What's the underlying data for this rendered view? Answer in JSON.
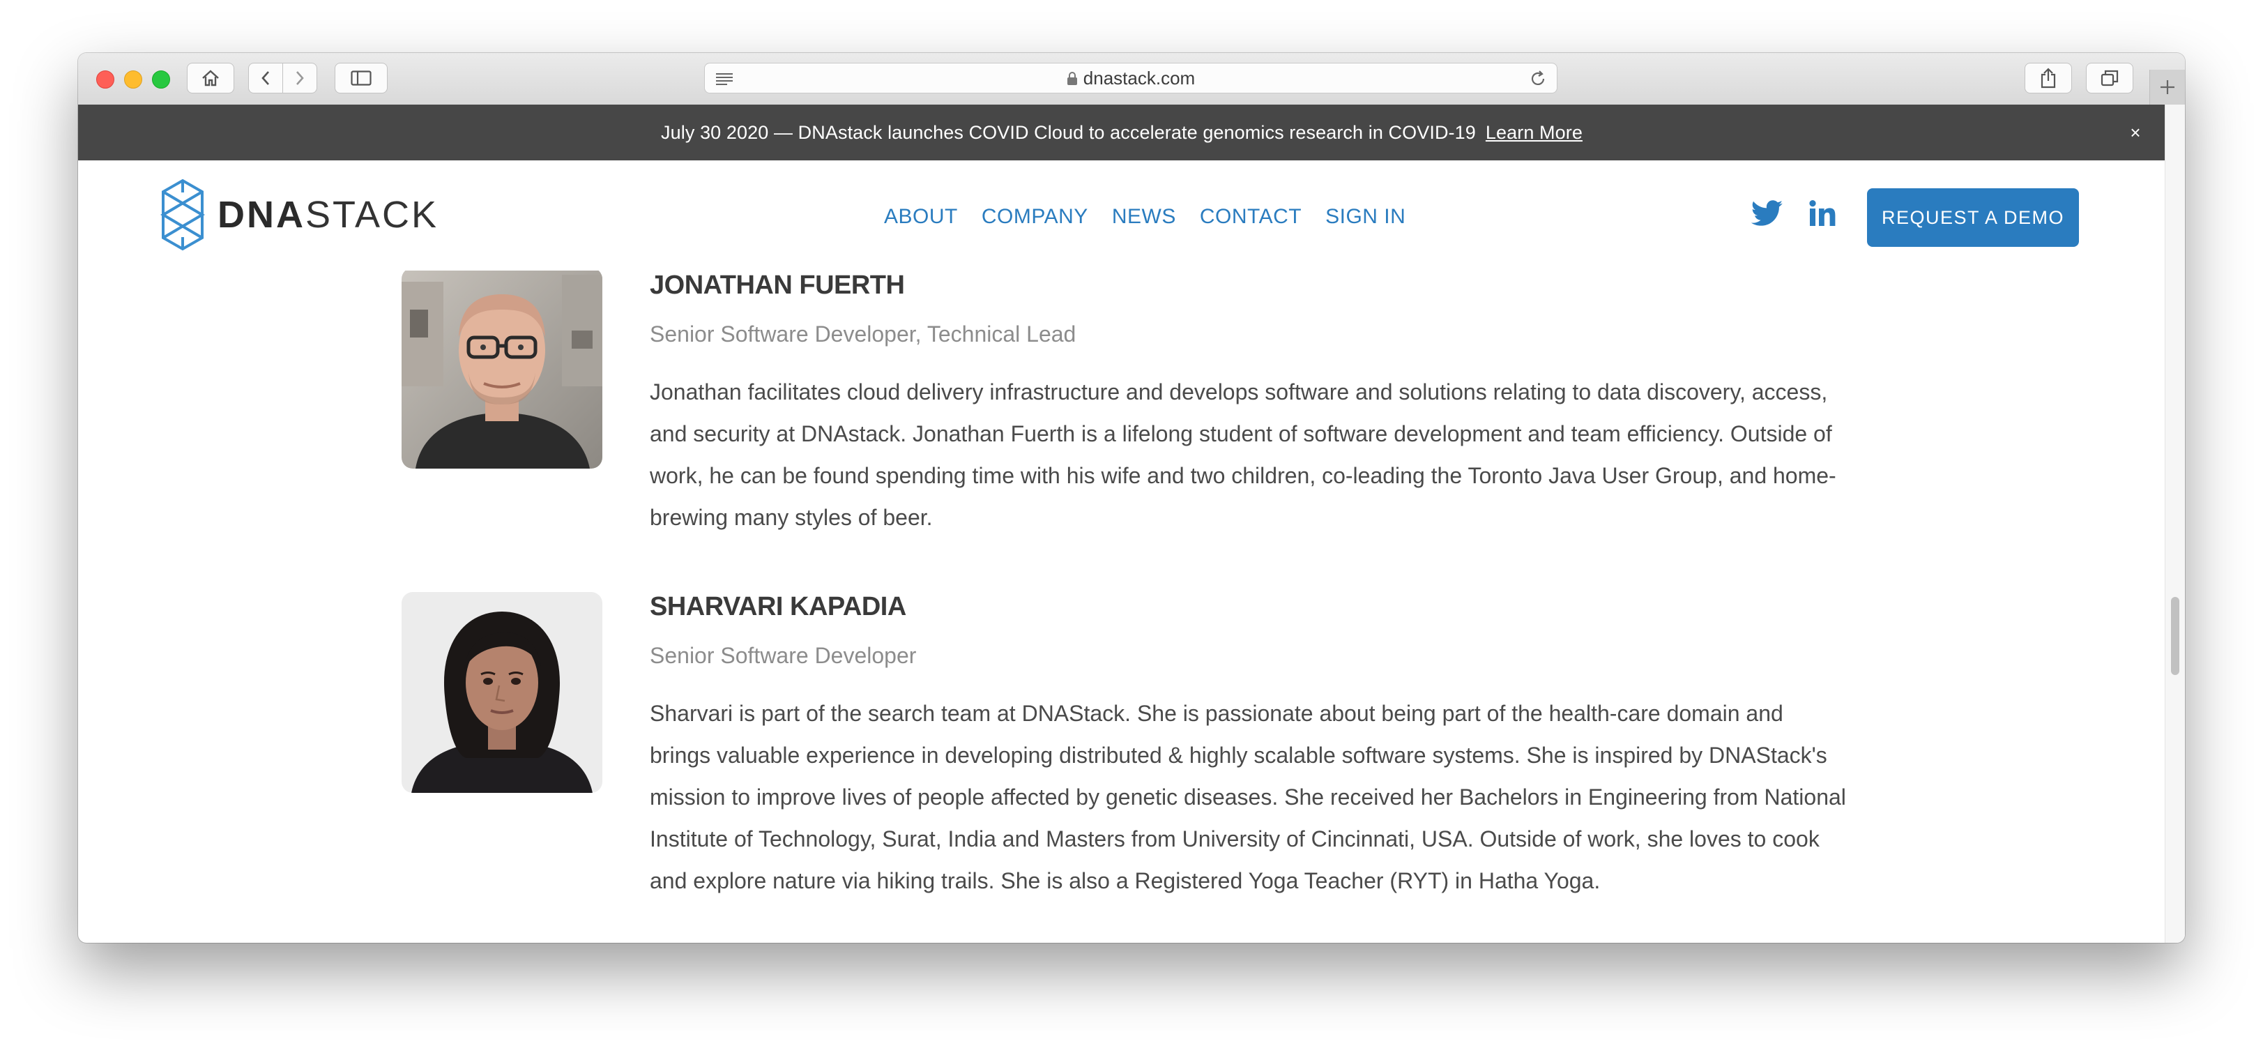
{
  "browser": {
    "url": "dnastack.com",
    "buttons": [
      "home-button",
      "back-button",
      "forward-button",
      "sidebar-button",
      "share-button",
      "tabs-button",
      "new-tab-button"
    ]
  },
  "announcement": {
    "text": "July 30 2020 — DNAstack launches COVID Cloud to accelerate genomics research in COVID-19",
    "link": "Learn More",
    "close": "×"
  },
  "header": {
    "logo_bold": "DNA",
    "logo_light": "STACK",
    "nav": [
      "ABOUT",
      "COMPANY",
      "NEWS",
      "CONTACT",
      "SIGN IN"
    ],
    "social": [
      "twitter-icon",
      "linkedin-icon"
    ],
    "cta": "REQUEST A DEMO"
  },
  "team": [
    {
      "name": "JONATHAN FUERTH",
      "title": "Senior Software Developer, Technical Lead",
      "bio": "Jonathan facilitates cloud delivery infrastructure and develops software and solutions relating to data discovery, access, and security at DNAstack. Jonathan Fuerth is a lifelong student of software development and team efficiency. Outside of work, he can be found spending time with his wife and two children, co-leading the Toronto Java User Group, and home-brewing many styles of beer."
    },
    {
      "name": "SHARVARI KAPADIA",
      "title": "Senior Software Developer",
      "bio": "Sharvari is part of the search team at DNAStack. She is passionate about being part of the health-care domain and brings valuable experience in developing distributed & highly scalable software systems. She is inspired by DNAStack's mission to improve lives of people affected by genetic diseases. She received her Bachelors in Engineering from National Institute of Technology, Surat, India and Masters from University of Cincinnati, USA. Outside of work, she loves to cook and explore nature via hiking trails. She is also a Registered Yoga Teacher (RYT) in Hatha Yoga."
    }
  ],
  "colors": {
    "brand_blue": "#2a7cbf",
    "announcement_bg": "#474747",
    "logo_mark": "#3b8fd0"
  }
}
